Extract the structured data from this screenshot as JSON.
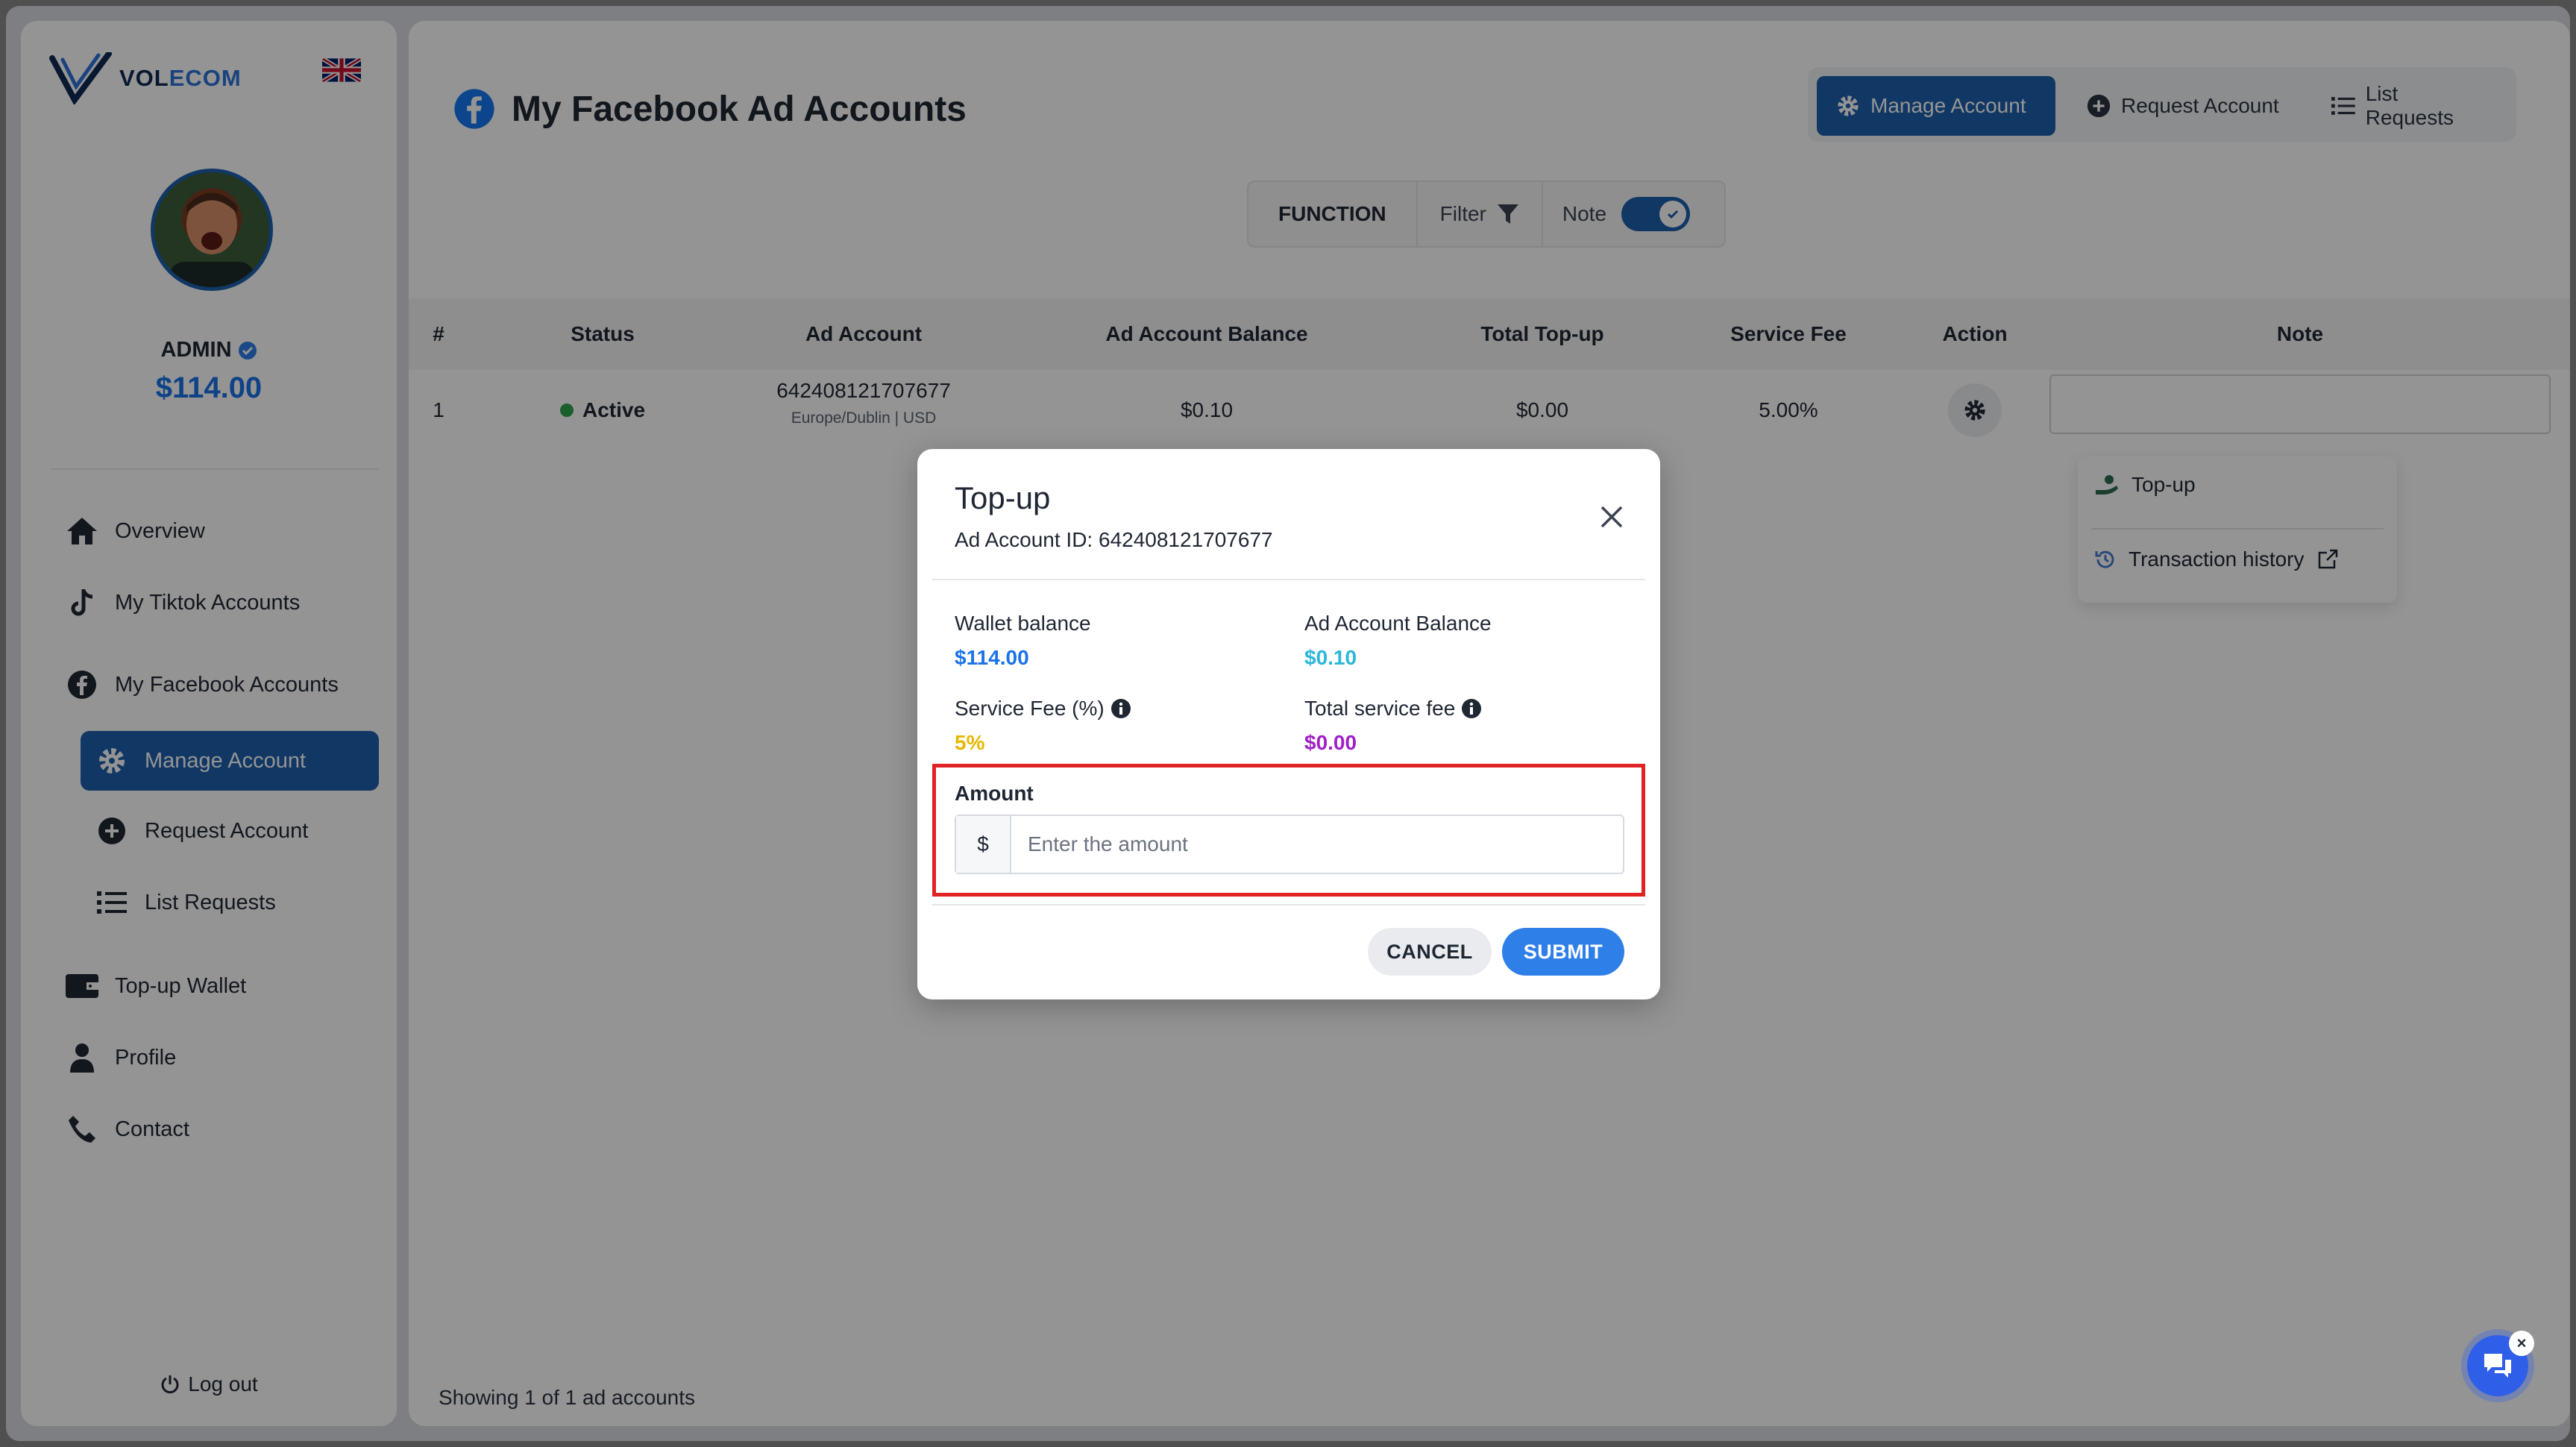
{
  "brand": {
    "name_part1": "VOL",
    "name_part2": "ECOM",
    "flag": "uk-flag-icon"
  },
  "user": {
    "name": "ADMIN",
    "balance": "$114.00"
  },
  "sidebar": {
    "items": [
      {
        "label": "Overview",
        "icon": "home-icon"
      },
      {
        "label": "My Tiktok Accounts",
        "icon": "tiktok-icon"
      },
      {
        "label": "My Facebook Accounts",
        "icon": "facebook-icon"
      },
      {
        "label": "Manage Account",
        "icon": "gear-icon",
        "active": true
      },
      {
        "label": "Request Account",
        "icon": "plus-circle-icon"
      },
      {
        "label": "List Requests",
        "icon": "list-icon"
      },
      {
        "label": "Top-up Wallet",
        "icon": "wallet-icon"
      },
      {
        "label": "Profile",
        "icon": "user-icon"
      },
      {
        "label": "Contact",
        "icon": "phone-icon"
      }
    ],
    "logout": "Log out"
  },
  "header": {
    "title": "My Facebook Ad Accounts",
    "tabs": [
      {
        "label": "Manage Account",
        "active": true
      },
      {
        "label": "Request Account"
      },
      {
        "label": "List Requests"
      }
    ]
  },
  "toolbar": {
    "function_label": "FUNCTION",
    "filter_label": "Filter",
    "note_label": "Note",
    "note_enabled": true
  },
  "table": {
    "columns": [
      "#",
      "Status",
      "Ad Account",
      "Ad Account Balance",
      "Total Top-up",
      "Service Fee",
      "Action",
      "Note"
    ],
    "rows": [
      {
        "index": "1",
        "status": "Active",
        "account_id": "642408121707677",
        "account_meta": "Europe/Dublin | USD",
        "balance": "$0.10",
        "total_topup": "$0.00",
        "service_fee": "5.00%"
      }
    ],
    "footer": "Showing 1 of 1 ad accounts"
  },
  "action_menu": {
    "topup": "Top-up",
    "history": "Transaction history"
  },
  "modal": {
    "title": "Top-up",
    "subtitle": "Ad Account ID: 642408121707677",
    "wallet_label": "Wallet balance",
    "wallet_value": "$114.00",
    "ad_balance_label": "Ad Account Balance",
    "ad_balance_value": "$0.10",
    "fee_label": "Service Fee (%)",
    "fee_value": "5%",
    "total_fee_label": "Total service fee",
    "total_fee_value": "$0.00",
    "amount_label": "Amount",
    "currency_prefix": "$",
    "amount_placeholder": "Enter the amount",
    "cancel": "CANCEL",
    "submit": "SUBMIT"
  },
  "colors": {
    "primary": "#1e5fae",
    "wallet": "#1b73e8",
    "ad_balance": "#2bb7d9",
    "fee": "#e6b800",
    "total_fee": "#a020c8",
    "active_dot": "#2ea44f",
    "highlight": "#e02424"
  }
}
